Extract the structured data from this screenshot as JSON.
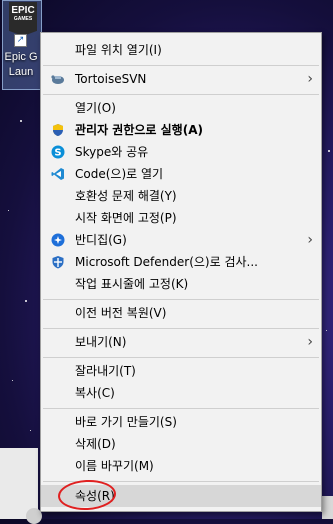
{
  "desktop_icon": {
    "logo_line1": "EPIC",
    "logo_line2": "GAMES",
    "label_line1": "Epic G",
    "label_line2": "Laun"
  },
  "menu": {
    "items": [
      {
        "label": "파일 위치 열기(I)",
        "icon": "none",
        "submenu": false
      },
      {
        "label": "TortoiseSVN",
        "icon": "tortoisesvn-icon",
        "submenu": true
      },
      {
        "label": "열기(O)",
        "icon": "none",
        "submenu": false
      },
      {
        "label": "관리자 권한으로 실행(A)",
        "icon": "uac-shield-icon",
        "submenu": false,
        "bold": true
      },
      {
        "label": "Skype와 공유",
        "icon": "skype-icon",
        "submenu": false
      },
      {
        "label": "Code(으)로 열기",
        "icon": "vscode-icon",
        "submenu": false
      },
      {
        "label": "호환성 문제 해결(Y)",
        "icon": "none",
        "submenu": false
      },
      {
        "label": "시작 화면에 고정(P)",
        "icon": "none",
        "submenu": false
      },
      {
        "label": "반디집(G)",
        "icon": "bandizip-icon",
        "submenu": true
      },
      {
        "label": "Microsoft Defender(으)로 검사...",
        "icon": "defender-icon",
        "submenu": false
      },
      {
        "label": "작업 표시줄에 고정(K)",
        "icon": "none",
        "submenu": false
      },
      {
        "label": "이전 버전 복원(V)",
        "icon": "none",
        "submenu": false
      },
      {
        "label": "보내기(N)",
        "icon": "none",
        "submenu": true
      },
      {
        "label": "잘라내기(T)",
        "icon": "none",
        "submenu": false
      },
      {
        "label": "복사(C)",
        "icon": "none",
        "submenu": false
      },
      {
        "label": "바로 가기 만들기(S)",
        "icon": "none",
        "submenu": false
      },
      {
        "label": "삭제(D)",
        "icon": "none",
        "submenu": false
      },
      {
        "label": "이름 바꾸기(M)",
        "icon": "none",
        "submenu": false
      },
      {
        "label": "속성(R)",
        "icon": "none",
        "submenu": false,
        "highlighted": true
      }
    ]
  },
  "colors": {
    "menu_bg": "#f2f2f2",
    "highlight": "#d7d7d7",
    "annotation_circle": "#e02020"
  }
}
